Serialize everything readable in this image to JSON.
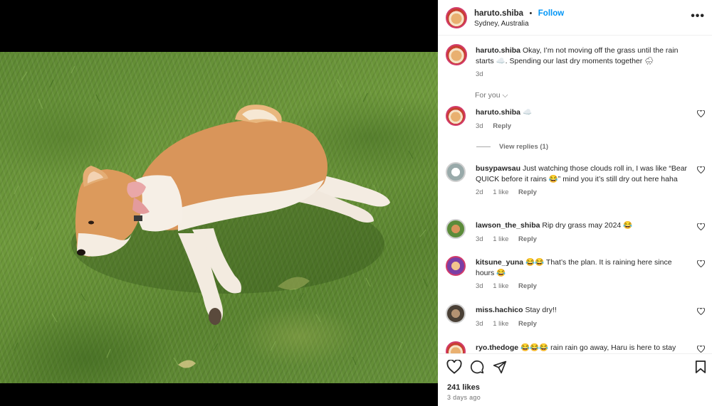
{
  "post": {
    "username": "haruto.shiba",
    "follow_label": "Follow",
    "separator": "•",
    "location": "Sydney, Australia",
    "more_label": "•••",
    "caption": "Okay, I’m not moving off the grass until the rain starts ☁️. Spending our last dry moments together 🌧",
    "caption_age": "3d",
    "for_you_label": "For you ⌵"
  },
  "comments": [
    {
      "username": "haruto.shiba",
      "text": "☁️",
      "age": "3d",
      "likes": "",
      "reply": "Reply",
      "view_replies": "View replies (1)"
    },
    {
      "username": "busypawsau",
      "text": "Just watching those clouds roll in, I was like “Bear QUICK before it rains 😂” mind you it’s still dry out here haha",
      "age": "2d",
      "likes": "1 like",
      "reply": "Reply"
    },
    {
      "username": "lawson_the_shiba",
      "text": "Rip dry grass may 2024 😂",
      "age": "3d",
      "likes": "1 like",
      "reply": "Reply"
    },
    {
      "username": "kitsune_yuna",
      "text": "😂😂 That’s the plan. It is raining here since hours 😂",
      "age": "3d",
      "likes": "1 like",
      "reply": "Reply"
    },
    {
      "username": "miss.hachico",
      "text": "Stay dry!!",
      "age": "3d",
      "likes": "1 like",
      "reply": "Reply"
    },
    {
      "username": "ryo.thedoge",
      "text": "😂😂😂 rain rain go away, Haru is here to stay",
      "age": "",
      "likes": "",
      "reply": ""
    }
  ],
  "footer": {
    "likes": "241 likes",
    "ago": "3 days ago"
  },
  "icons": {
    "heart": "heart-icon",
    "comment": "comment-icon",
    "share": "share-icon",
    "bookmark": "bookmark-icon"
  },
  "colors": {
    "link_blue": "#0095f6",
    "muted": "#737373",
    "story_ring": "#d23b6b"
  }
}
